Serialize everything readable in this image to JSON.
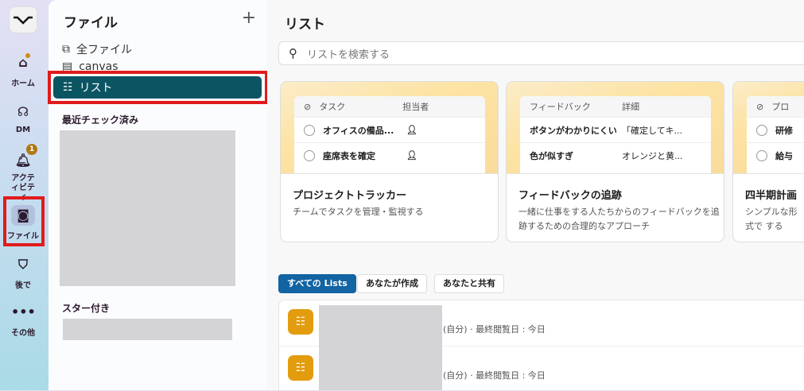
{
  "rail": {
    "items": [
      {
        "label": "ホーム"
      },
      {
        "label": "DM"
      },
      {
        "label": "アクティビティ",
        "badge": "1"
      },
      {
        "label": "ファイル"
      },
      {
        "label": "後で"
      },
      {
        "label": "その他"
      }
    ]
  },
  "sidebar": {
    "title": "ファイル",
    "add": "+",
    "items": [
      {
        "label": "全ファイル"
      },
      {
        "label": "canvas"
      },
      {
        "label": "リスト"
      }
    ],
    "recent_heading": "最近チェック済み",
    "starred_heading": "スター付き"
  },
  "main": {
    "title": "リスト",
    "search_placeholder": "リストを検索する",
    "cards": [
      {
        "headers": [
          "タスク",
          "担当者"
        ],
        "rows": [
          [
            "オフィスの備品...",
            ""
          ],
          [
            "座席表を確定",
            ""
          ]
        ],
        "title": "プロジェクトトラッカー",
        "desc": "チームでタスクを管理・監視する"
      },
      {
        "headers": [
          "フィードバック",
          "詳細"
        ],
        "rows": [
          [
            "ボタンがわかりにくい",
            "「確定してキ..."
          ],
          [
            "色が似すぎ",
            "オレンジと黄..."
          ]
        ],
        "title": "フィードバックの追跡",
        "desc": "一緒に仕事をする人たちからのフィードバックを追跡するための合理的なアプローチ"
      },
      {
        "headers": [
          "プロ",
          ""
        ],
        "rows": [
          [
            "研修",
            ""
          ],
          [
            "給与",
            ""
          ]
        ],
        "title": "四半期計画",
        "desc": "シンプルな形式で する"
      }
    ],
    "tabs": [
      "すべての Lists",
      "あなたが作成",
      "あなたと共有"
    ],
    "rows": [
      {
        "meta": "(自分) · 最終閲覧日 : 今日"
      },
      {
        "meta": "(自分) · 最終閲覧日 : 今日"
      }
    ]
  },
  "colors": {
    "accent": "#0b5563",
    "tab_active": "#1264a3",
    "list_icon": "#e29c0e",
    "highlight": "#e01b1b"
  }
}
